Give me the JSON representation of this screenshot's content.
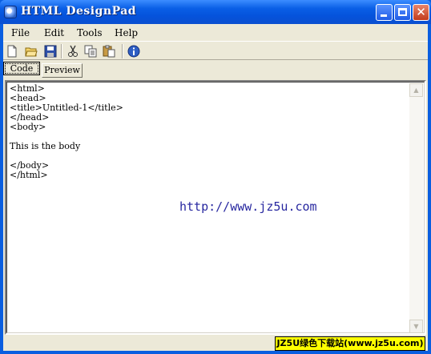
{
  "window": {
    "title": "HTML DesignPad"
  },
  "menu": {
    "items": [
      "File",
      "Edit",
      "Tools",
      "Help"
    ]
  },
  "toolbar": {
    "buttons": [
      "new-file-icon",
      "open-folder-icon",
      "save-icon",
      "cut-icon",
      "copy-icon",
      "paste-icon",
      "info-icon"
    ]
  },
  "tabs": {
    "code": "Code",
    "preview": "Preview"
  },
  "editor": {
    "lines": [
      "<html>",
      "<head>",
      "<title>Untitled-1</title>",
      "</head>",
      "<body>",
      "",
      "This is the body",
      "",
      "</body>",
      "</html>"
    ]
  },
  "watermark": "http://www.jz5u.com",
  "badge": "JZ5U绿色下载站(www.jz5u.com)"
}
